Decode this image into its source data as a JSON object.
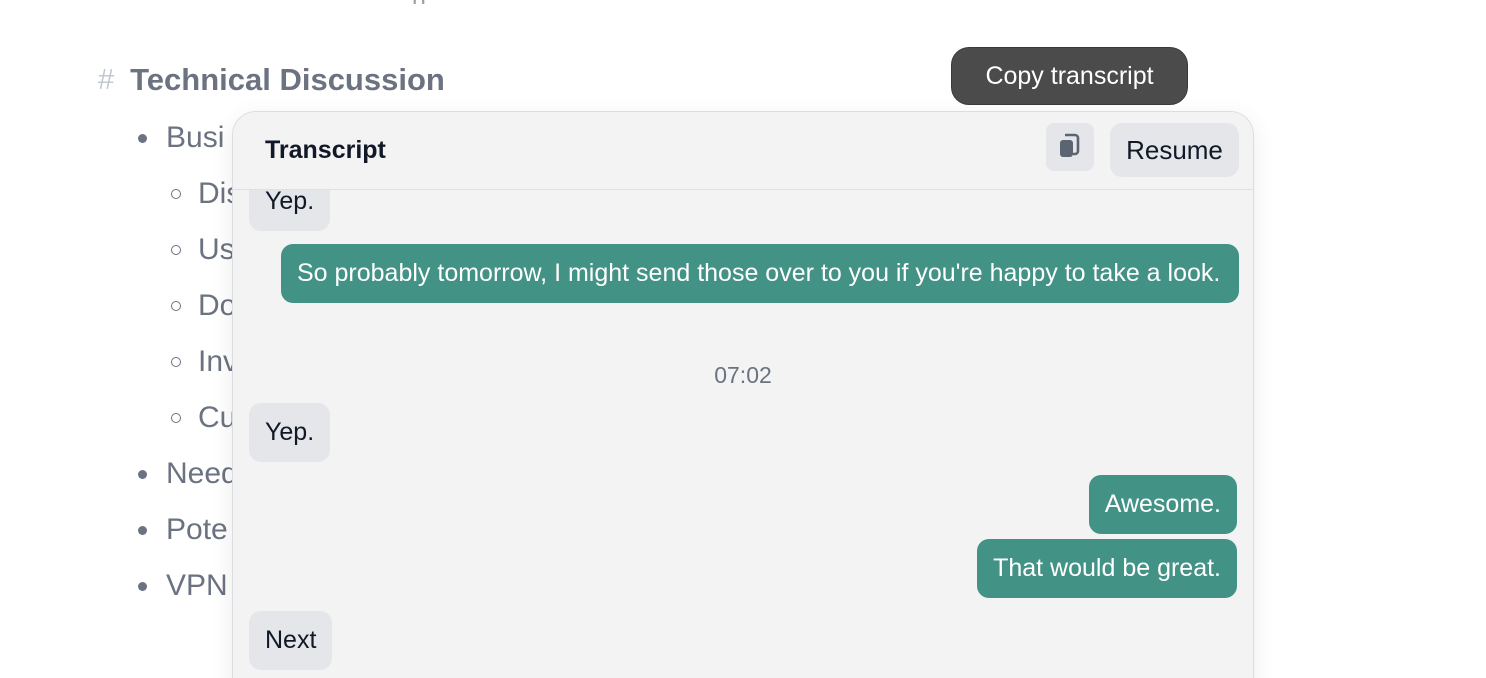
{
  "notes": {
    "heading_hash": "#",
    "heading": "Technical Discussion",
    "top_fragment": "p",
    "items": [
      {
        "label": "Busi",
        "level": 1
      },
      {
        "label": "Dis",
        "level": 2
      },
      {
        "label": "Us",
        "level": 2
      },
      {
        "label": "Do",
        "level": 2
      },
      {
        "label": "Inv",
        "level": 2
      },
      {
        "label": "Cu",
        "level": 2
      },
      {
        "label": "Need",
        "level": 1
      },
      {
        "label": "Pote",
        "level": 1
      },
      {
        "label": "VPN",
        "level": 1
      }
    ]
  },
  "tooltip": {
    "text": "Copy transcript"
  },
  "transcript": {
    "title": "Transcript",
    "copy_icon": "copy-icon",
    "resume_label": "Resume",
    "messages": [
      {
        "speaker": "other",
        "text": "Yep."
      },
      {
        "speaker": "self",
        "text": "So probably tomorrow, I might send those over to you if you're happy to take a look."
      },
      {
        "timestamp": "07:02"
      },
      {
        "speaker": "other",
        "text": "Yep."
      },
      {
        "speaker": "self",
        "text": "Awesome."
      },
      {
        "speaker": "self",
        "text": "That would be great."
      },
      {
        "speaker": "other",
        "text": "Next"
      }
    ]
  },
  "colors": {
    "self_bubble": "#439286",
    "other_bubble": "#e5e6ea",
    "panel_bg": "#f3f3f4",
    "tooltip_bg": "#4b4b4b"
  }
}
